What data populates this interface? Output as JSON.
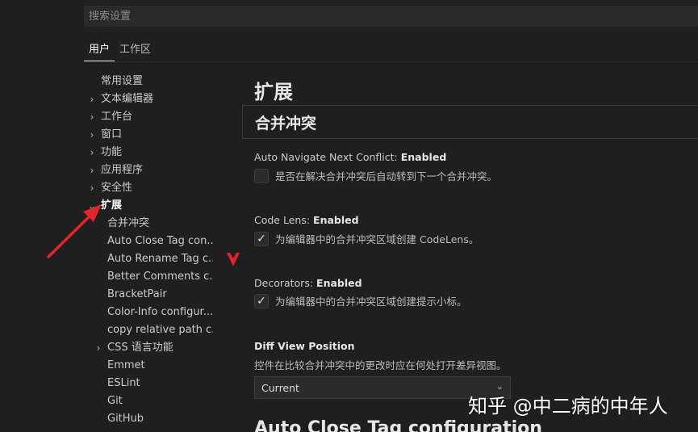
{
  "search": {
    "placeholder": "搜索设置"
  },
  "tabs": [
    {
      "label": "用户",
      "active": true
    },
    {
      "label": "工作区",
      "active": false
    }
  ],
  "toc": [
    {
      "label": "常用设置",
      "level": 0,
      "chevron": ""
    },
    {
      "label": "文本编辑器",
      "level": 0,
      "chevron": "›"
    },
    {
      "label": "工作台",
      "level": 0,
      "chevron": "›"
    },
    {
      "label": "窗口",
      "level": 0,
      "chevron": "›"
    },
    {
      "label": "功能",
      "level": 0,
      "chevron": "›"
    },
    {
      "label": "应用程序",
      "level": 0,
      "chevron": "›"
    },
    {
      "label": "安全性",
      "level": 0,
      "chevron": "›"
    },
    {
      "label": "扩展",
      "level": 0,
      "chevron": "⌄",
      "selected": true
    },
    {
      "label": "合并冲突",
      "level": 1,
      "chevron": ""
    },
    {
      "label": "Auto Close Tag con...",
      "level": 1,
      "chevron": ""
    },
    {
      "label": "Auto Rename Tag c...",
      "level": 1,
      "chevron": ""
    },
    {
      "label": "Better Comments c...",
      "level": 1,
      "chevron": ""
    },
    {
      "label": "BracketPair",
      "level": 1,
      "chevron": ""
    },
    {
      "label": "Color-Info configur...",
      "level": 1,
      "chevron": ""
    },
    {
      "label": "copy relative path c...",
      "level": 1,
      "chevron": ""
    },
    {
      "label": "CSS 语言功能",
      "level": 1,
      "chevron": "›"
    },
    {
      "label": "Emmet",
      "level": 1,
      "chevron": ""
    },
    {
      "label": "ESLint",
      "level": 1,
      "chevron": ""
    },
    {
      "label": "Git",
      "level": 1,
      "chevron": ""
    },
    {
      "label": "GitHub",
      "level": 1,
      "chevron": ""
    }
  ],
  "content": {
    "section_title": "扩展",
    "group_title": "合并冲突",
    "settings": {
      "auto_navigate": {
        "prefix": "Auto Navigate Next Conflict: ",
        "name": "Enabled",
        "checked": false,
        "desc": "是否在解决合并冲突后自动转到下一个合并冲突。"
      },
      "code_lens": {
        "prefix": "Code Lens: ",
        "name": "Enabled",
        "checked": true,
        "desc": "为编辑器中的合并冲突区域创建 CodeLens。"
      },
      "decorators": {
        "prefix": "Decorators: ",
        "name": "Enabled",
        "checked": true,
        "desc": "为编辑器中的合并冲突区域创建提示小标。"
      },
      "diff_view": {
        "title": "Diff View Position",
        "desc": "控件在比较合并冲突中的更改时应在何处打开差异视图。",
        "value": "Current"
      }
    },
    "next_section_title": "Auto Close Tag configuration"
  },
  "annotations": {
    "arrow_color": "#e0262b"
  },
  "watermark": "知乎 @中二病的中年人"
}
